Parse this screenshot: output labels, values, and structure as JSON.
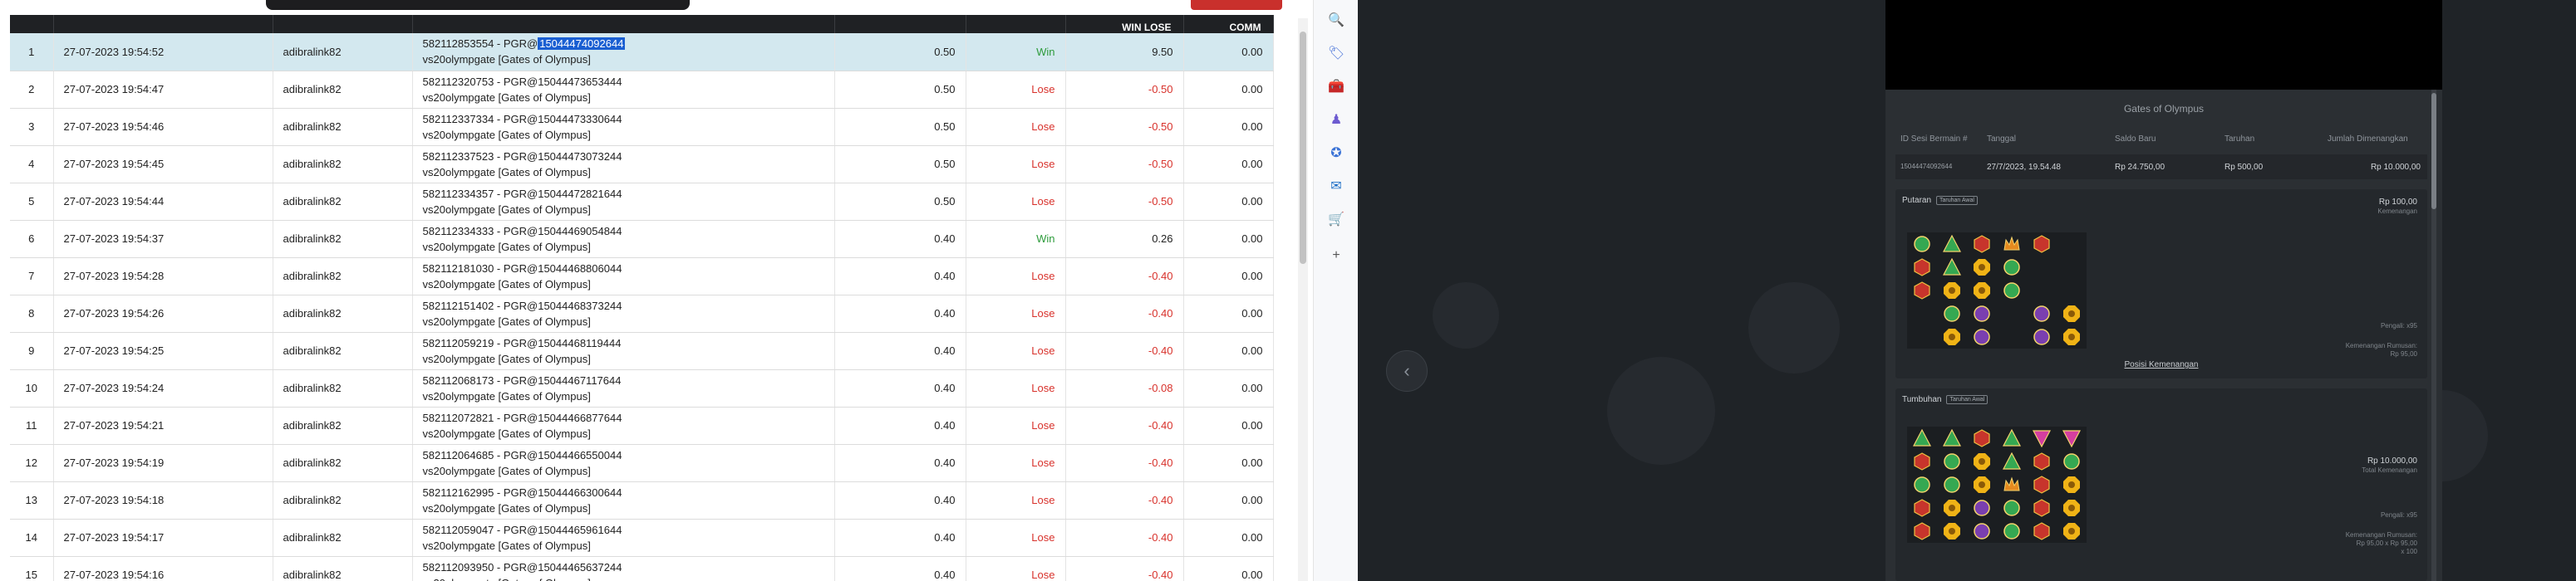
{
  "table": {
    "headers": [
      "",
      "",
      "",
      "",
      "",
      "",
      "WIN LOSE",
      "COMM"
    ],
    "selected_row": 0,
    "highlight": "15044474092644",
    "rows": [
      {
        "no": "1",
        "time": "27-07-2023 19:54:52",
        "user": "adibralink82",
        "desc1_prefix": "582112853554 - PGR@",
        "desc1_hl": "15044474092644",
        "desc1": "",
        "desc2": "vs20olympgate [Gates of Olympus]",
        "bet": "0.50",
        "result": "Win",
        "winlose": "9.50",
        "comm": "0.00"
      },
      {
        "no": "2",
        "time": "27-07-2023 19:54:47",
        "user": "adibralink82",
        "desc1": "582112320753 - PGR@15044473653444",
        "desc2": "vs20olympgate [Gates of Olympus]",
        "bet": "0.50",
        "result": "Lose",
        "winlose": "-0.50",
        "comm": "0.00"
      },
      {
        "no": "3",
        "time": "27-07-2023 19:54:46",
        "user": "adibralink82",
        "desc1": "582112337334 - PGR@15044473330644",
        "desc2": "vs20olympgate [Gates of Olympus]",
        "bet": "0.50",
        "result": "Lose",
        "winlose": "-0.50",
        "comm": "0.00"
      },
      {
        "no": "4",
        "time": "27-07-2023 19:54:45",
        "user": "adibralink82",
        "desc1": "582112337523 - PGR@15044473073244",
        "desc2": "vs20olympgate [Gates of Olympus]",
        "bet": "0.50",
        "result": "Lose",
        "winlose": "-0.50",
        "comm": "0.00"
      },
      {
        "no": "5",
        "time": "27-07-2023 19:54:44",
        "user": "adibralink82",
        "desc1": "582112334357 - PGR@15044472821644",
        "desc2": "vs20olympgate [Gates of Olympus]",
        "bet": "0.50",
        "result": "Lose",
        "winlose": "-0.50",
        "comm": "0.00"
      },
      {
        "no": "6",
        "time": "27-07-2023 19:54:37",
        "user": "adibralink82",
        "desc1": "582112334333 - PGR@15044469054844",
        "desc2": "vs20olympgate [Gates of Olympus]",
        "bet": "0.40",
        "result": "Win",
        "winlose": "0.26",
        "comm": "0.00"
      },
      {
        "no": "7",
        "time": "27-07-2023 19:54:28",
        "user": "adibralink82",
        "desc1": "582112181030 - PGR@15044468806044",
        "desc2": "vs20olympgate [Gates of Olympus]",
        "bet": "0.40",
        "result": "Lose",
        "winlose": "-0.40",
        "comm": "0.00"
      },
      {
        "no": "8",
        "time": "27-07-2023 19:54:26",
        "user": "adibralink82",
        "desc1": "582112151402 - PGR@15044468373244",
        "desc2": "vs20olympgate [Gates of Olympus]",
        "bet": "0.40",
        "result": "Lose",
        "winlose": "-0.40",
        "comm": "0.00"
      },
      {
        "no": "9",
        "time": "27-07-2023 19:54:25",
        "user": "adibralink82",
        "desc1": "582112059219 - PGR@15044468119444",
        "desc2": "vs20olympgate [Gates of Olympus]",
        "bet": "0.40",
        "result": "Lose",
        "winlose": "-0.40",
        "comm": "0.00"
      },
      {
        "no": "10",
        "time": "27-07-2023 19:54:24",
        "user": "adibralink82",
        "desc1": "582112068173 - PGR@15044467117644",
        "desc2": "vs20olympgate [Gates of Olympus]",
        "bet": "0.40",
        "result": "Lose",
        "winlose": "-0.08",
        "comm": "0.00"
      },
      {
        "no": "11",
        "time": "27-07-2023 19:54:21",
        "user": "adibralink82",
        "desc1": "582112072821 - PGR@15044466877644",
        "desc2": "vs20olympgate [Gates of Olympus]",
        "bet": "0.40",
        "result": "Lose",
        "winlose": "-0.40",
        "comm": "0.00"
      },
      {
        "no": "12",
        "time": "27-07-2023 19:54:19",
        "user": "adibralink82",
        "desc1": "582112064685 - PGR@15044466550044",
        "desc2": "vs20olympgate [Gates of Olympus]",
        "bet": "0.40",
        "result": "Lose",
        "winlose": "-0.40",
        "comm": "0.00"
      },
      {
        "no": "13",
        "time": "27-07-2023 19:54:18",
        "user": "adibralink82",
        "desc1": "582112162995 - PGR@15044466300644",
        "desc2": "vs20olympgate [Gates of Olympus]",
        "bet": "0.40",
        "result": "Lose",
        "winlose": "-0.40",
        "comm": "0.00"
      },
      {
        "no": "14",
        "time": "27-07-2023 19:54:17",
        "user": "adibralink82",
        "desc1": "582112059047 - PGR@15044465961644",
        "desc2": "vs20olympgate [Gates of Olympus]",
        "bet": "0.40",
        "result": "Lose",
        "winlose": "-0.40",
        "comm": "0.00"
      },
      {
        "no": "15",
        "time": "27-07-2023 19:54:16",
        "user": "adibralink82",
        "desc1": "582112093950 - PGR@15044465637244",
        "desc2": "vs20olympgate [Gates of Olympus]",
        "bet": "0.40",
        "result": "Lose",
        "winlose": "-0.40",
        "comm": "0.00"
      }
    ]
  },
  "sidebar_icons": [
    {
      "name": "search-icon",
      "glyph": "🔍",
      "color": "#4a74d8"
    },
    {
      "name": "tag-icon",
      "glyph": "🏷",
      "color": "#4a74d8"
    },
    {
      "name": "toolbox-icon",
      "glyph": "🧰",
      "color": "#c0392b"
    },
    {
      "name": "person-icon",
      "glyph": "♟",
      "color": "#6d5bd0"
    },
    {
      "name": "copilot-icon",
      "glyph": "✪",
      "color": "#3b73d6"
    },
    {
      "name": "outlook-icon",
      "glyph": "✉",
      "color": "#1e6fc6"
    },
    {
      "name": "shopping-cart-icon",
      "glyph": "🛒",
      "color": "#2f9a4a"
    },
    {
      "name": "add-icon",
      "glyph": "+",
      "color": "#555555"
    }
  ],
  "game": {
    "title": "Gates of Olympus",
    "columns": [
      "ID Sesi Bermain #",
      "Tanggal",
      "Saldo Baru",
      "Taruhan",
      "Jumlah Dimenangkan"
    ],
    "summary": [
      "1504447409264​4",
      "27/7/2023, 19.54.48",
      "Rp 24.750,00",
      "Rp 500,00",
      "Rp 10.000,00"
    ],
    "spin_card": {
      "label": "Putaran",
      "badge": "Taruhan Awal",
      "amount": "Rp 100,00",
      "amount_sub": "Kemenangan",
      "info1": "Pengali: x95",
      "info2a": "Kemenangan Rumusan:",
      "info2b": "Rp 95,00",
      "link": "Posisi Kemenangan"
    },
    "tumble_card": {
      "label": "Tumbuhan",
      "badge": "Taruhan Awal",
      "amount": "Rp 10.000,00",
      "amount_sub": "Total Kemenangan",
      "info1": "Pengali: x95",
      "info2a": "Kemenangan Rumusan:",
      "info2b": "Rp 95,00 x Rp 95,00",
      "info2c": "x 100"
    },
    "colors": {
      "green": "#35a852",
      "red": "#c7352c",
      "gold": "#f0b316",
      "purple": "#7a3fb0",
      "pink": "#d43ea0",
      "blue": "#3c7bd4"
    },
    "grid1": [
      [
        "G",
        "T",
        "R",
        "O",
        "R",
        ""
      ],
      [
        "R",
        "T",
        "Y",
        "G",
        "",
        ""
      ],
      [
        "R",
        "Y",
        "Y",
        "G",
        "",
        ""
      ],
      [
        "",
        "G",
        "P",
        "",
        "P",
        "Y"
      ],
      [
        "",
        "Y",
        "P",
        "",
        "P",
        "Y"
      ]
    ],
    "grid2": [
      [
        "T",
        "T",
        "R",
        "T",
        "V",
        "V"
      ],
      [
        "R",
        "G",
        "Y",
        "T",
        "R",
        "G"
      ],
      [
        "G",
        "G",
        "Y",
        "O",
        "R",
        "Y"
      ],
      [
        "R",
        "Y",
        "P",
        "G",
        "R",
        "Y"
      ],
      [
        "R",
        "Y",
        "P",
        "G",
        "R",
        "Y"
      ]
    ]
  }
}
